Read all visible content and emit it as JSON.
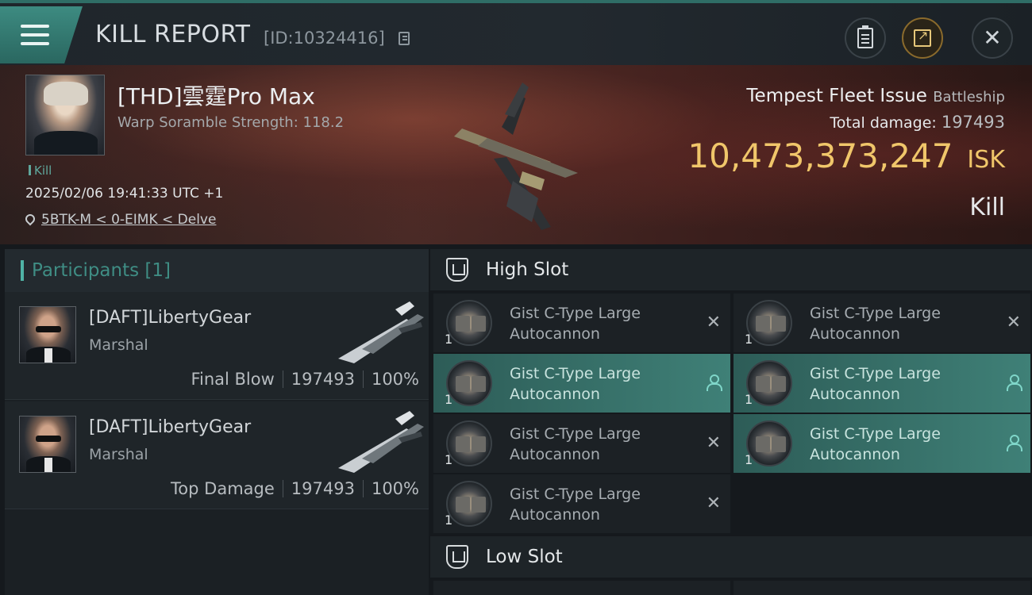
{
  "header": {
    "title": "KILL REPORT",
    "report_id": "[ID:10324416]"
  },
  "victim": {
    "name": "[THD]雲霆Pro Max",
    "scramble": "Warp Soramble Strength: 118.2",
    "kill_tag": "Kill",
    "datetime": "2025/02/06 19:41:33 UTC +1",
    "location": "5BTK-M < 0-EIMK < Delve",
    "ship_name": "Tempest Fleet Issue",
    "ship_class": "Battleship",
    "total_damage_label": "Total damage:",
    "total_damage": "197493",
    "isk_value": "10,473,373,247",
    "isk_unit": "ISK",
    "result": "Kill"
  },
  "participants": {
    "label": "Participants [1]",
    "items": [
      {
        "name": "[DAFT]LibertyGear",
        "rank": "Marshal",
        "role": "Final Blow",
        "damage": "197493",
        "percent": "100%"
      },
      {
        "name": "[DAFT]LibertyGear",
        "rank": "Marshal",
        "role": "Top Damage",
        "damage": "197493",
        "percent": "100%"
      }
    ]
  },
  "high_slot": {
    "label": "High Slot",
    "modules": [
      {
        "qty": "1",
        "name": "Gist C-Type Large Autocannon",
        "state": "destroyed"
      },
      {
        "qty": "1",
        "name": "Gist C-Type Large Autocannon",
        "state": "destroyed"
      },
      {
        "qty": "1",
        "name": "Gist C-Type Large Autocannon",
        "state": "dropped"
      },
      {
        "qty": "1",
        "name": "Gist C-Type Large Autocannon",
        "state": "dropped"
      },
      {
        "qty": "1",
        "name": "Gist C-Type Large Autocannon",
        "state": "destroyed"
      },
      {
        "qty": "1",
        "name": "Gist C-Type Large Autocannon",
        "state": "dropped"
      },
      {
        "qty": "1",
        "name": "Gist C-Type Large Autocannon",
        "state": "destroyed"
      }
    ]
  },
  "low_slot": {
    "label": "Low Slot"
  },
  "icons": {
    "menu": "hamburger-menu-icon",
    "copy": "copy-icon",
    "clipboard": "clipboard-icon",
    "share": "share-icon",
    "close": "close-icon",
    "location": "map-pin-icon",
    "slot": "shield-icon",
    "destroyed": "x-icon",
    "dropped": "person-icon"
  },
  "colors": {
    "accent": "#3f8d84",
    "isk": "#f0c66a",
    "active_module": "#3f8077"
  }
}
